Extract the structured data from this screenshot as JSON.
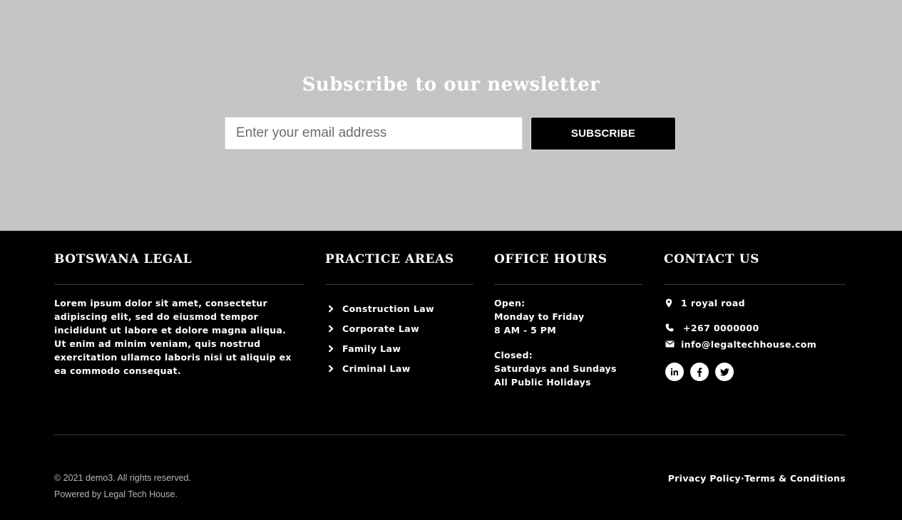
{
  "newsletter": {
    "title": "Subscribe to our newsletter",
    "email_placeholder": "Enter your email address",
    "subscribe_label": "SUBSCRIBE"
  },
  "footer": {
    "about": {
      "title": "BOTSWANA LEGAL",
      "text": "Lorem ipsum dolor sit amet, consectetur adipiscing elit, sed do eiusmod tempor incididunt ut labore et dolore magna aliqua. Ut enim ad minim veniam, quis nostrud exercitation ullamco laboris nisi ut aliquip ex ea commodo consequat."
    },
    "practice": {
      "title": "PRACTICE AREAS",
      "items": [
        {
          "label": "Construction Law"
        },
        {
          "label": "Corporate Law"
        },
        {
          "label": "Family Law"
        },
        {
          "label": "Criminal Law"
        }
      ]
    },
    "hours": {
      "title": "OFFICE HOURS",
      "open_label": "Open:",
      "open_days": "Monday to Friday",
      "open_times": "8 AM - 5 PM",
      "closed_label": "Closed:",
      "closed_days": "Saturdays and Sundays",
      "closed_holidays": "All Public Holidays"
    },
    "contact": {
      "title": "CONTACT US",
      "address": "1 royal road",
      "phone": "+267 0000000",
      "email": "info@legaltechhouse.com",
      "social": [
        "linkedin-icon",
        "facebook-icon",
        "twitter-icon"
      ]
    },
    "copyright": "© 2021 demo3. All rights reserved.",
    "powered": "Powered by Legal Tech House.",
    "privacy": "Privacy Policy",
    "separator": "·",
    "terms": "Terms & Conditions"
  },
  "colors": {
    "newsletter_bg": "#c4c4c4",
    "footer_bg": "#000000",
    "text": "#ffffff",
    "muted": "#b7b7b7"
  }
}
